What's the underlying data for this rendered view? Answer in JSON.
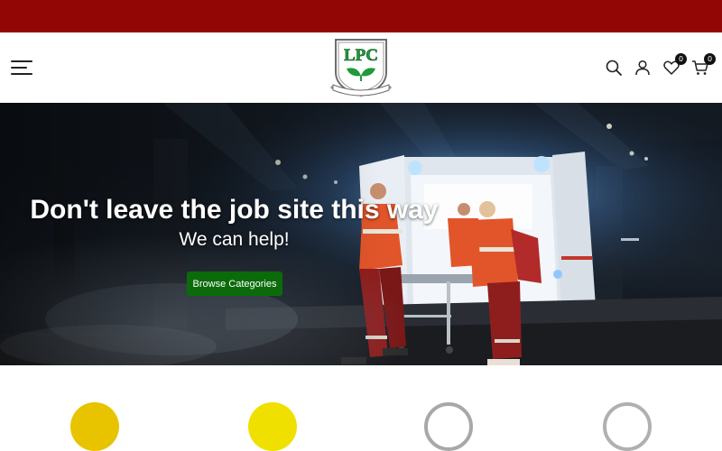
{
  "announcement": {
    "color": "#930606"
  },
  "header": {
    "menu_icon": "hamburger-menu-icon",
    "logo": {
      "text": "LPC",
      "tagline": "Protecting Workers Since 1979"
    },
    "icons": {
      "search": "search-icon",
      "account": "user-icon",
      "wishlist": {
        "icon": "heart-icon",
        "count": "0"
      },
      "cart": {
        "icon": "cart-icon",
        "count": "0"
      }
    }
  },
  "hero": {
    "title": "Don't leave the job site this way",
    "subtitle": "We can help!",
    "button_label": "Browse Categories",
    "button_color": "#0b6b0b"
  },
  "categories": {
    "circle_colors": [
      "#e8c300",
      "#f0e000",
      "#a8a8a8",
      "#b0b0b0"
    ]
  }
}
